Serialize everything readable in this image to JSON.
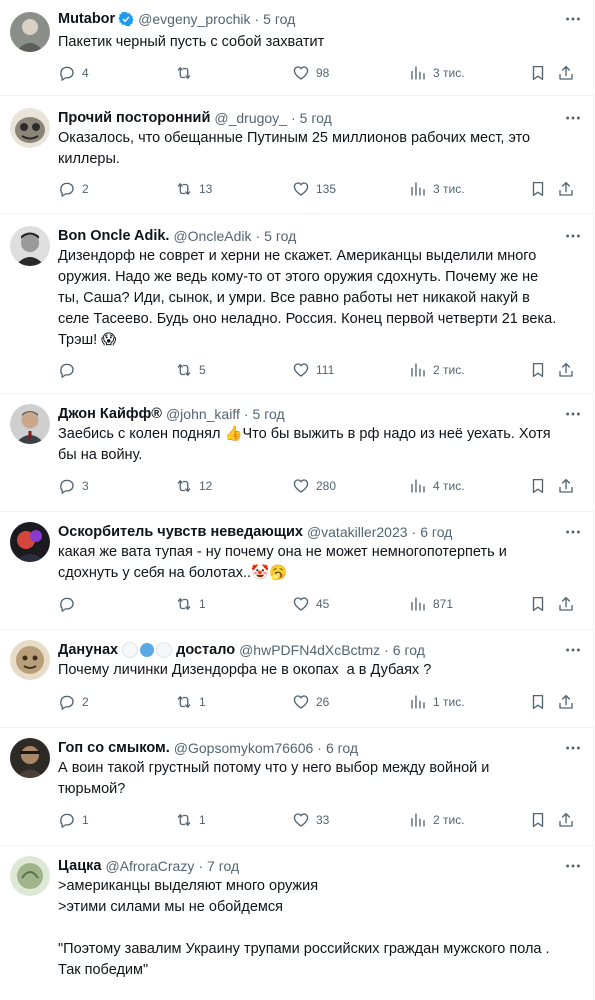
{
  "tweets": [
    {
      "name": "Mutabor",
      "verified": true,
      "handle": "@evgeny_prochik",
      "time": "5 год",
      "lines": [
        "Пакетик черный пусть с собой захватит"
      ],
      "replies": "4",
      "retweets": "",
      "likes": "98",
      "views": "3 тис."
    },
    {
      "name": "Прочий посторонний",
      "handle": "@_drugoy_",
      "time": "5 год",
      "lines": [
        "Оказалось, что обещанные Путиным 25 миллионов рабочих мест, это",
        "киллеры."
      ],
      "replies": "2",
      "retweets": "13",
      "likes": "135",
      "views": "3 тис."
    },
    {
      "name": "Bon Oncle Adik.",
      "handle": "@OncleAdik",
      "time": "5 год",
      "lines": [
        "Дизендорф не соврет и херни не скажет. Американцы выделили много",
        "оружия. Надо же ведь кому-то от этого оружия сдохнуть. Почему же не",
        "ты, Саша? Иди, сынок, и умри. Все равно работы нет никакой накуй в",
        "селе Тасеево. Будь оно неладно. Россия. Конец первой четверти 21 века.",
        "Трэш! 😱"
      ],
      "replies": "",
      "retweets": "5",
      "likes": "111",
      "views": "2 тис."
    },
    {
      "name": "Джон Кайфф®",
      "handle": "@john_kaiff",
      "time": "5 год",
      "lines": [
        "Заебись с колен поднял 👍Что бы выжить в рф надо из неё уехать. Хотя",
        "бы на войну."
      ],
      "replies": "3",
      "retweets": "12",
      "likes": "280",
      "views": "4 тис."
    },
    {
      "name": "Оскорбитель чувств неведающих",
      "handle": "@vatakiller2023",
      "time": "6 год",
      "lines": [
        "какая же вата тупая - ну почему она не может немногопотерпеть и",
        "сдохнуть у себя на болотах..🤡🥱"
      ],
      "replies": "",
      "retweets": "1",
      "likes": "45",
      "views": "871"
    },
    {
      "name_parts": [
        "Данунах",
        "достало"
      ],
      "handle": "@hwPDFN4dXcBctmz",
      "time": "6 год",
      "hearts": [
        "#f5f8fa",
        "#5aa9e6",
        "#f5f8fa"
      ],
      "lines": [
        "Почему личинки Дизендорфа не в окопах  а в Дубаях ?"
      ],
      "replies": "2",
      "retweets": "1",
      "likes": "26",
      "views": "1 тис."
    },
    {
      "name": "Гоп со смыком.",
      "handle": "@Gopsomykom76606",
      "time": "6 год",
      "lines": [
        "А воин такой грустный потому что у него выбор между войной и",
        "тюрьмой?"
      ],
      "replies": "1",
      "retweets": "1",
      "likes": "33",
      "views": "2 тис."
    },
    {
      "name": "Цацка",
      "handle": "@AfroraCrazy",
      "time": "7 год",
      "lines": [
        ">американцы выделяют много оружия",
        ">этими силами мы не обойдемся",
        "",
        "\"Поэтому завалим Украину трупами российских граждан мужского пола .",
        "Так победим\""
      ]
    }
  ],
  "colors": {
    "text": "#0f1419",
    "muted": "#536471",
    "verified": "#1d9bf0",
    "divider": "#eff3f4"
  }
}
